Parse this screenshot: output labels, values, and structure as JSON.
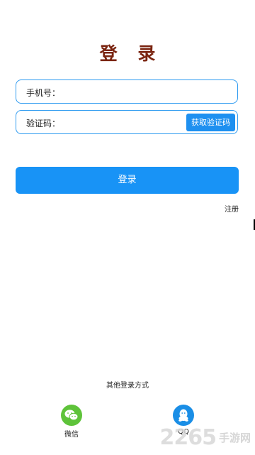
{
  "page": {
    "title": "登 录"
  },
  "form": {
    "phone_label": "手机号：",
    "code_label": "验证码：",
    "get_code_label": "获取验证码"
  },
  "actions": {
    "login_label": "登录",
    "register_label": "注册"
  },
  "other_login": {
    "title": "其他登录方式",
    "options": [
      {
        "label": "微信",
        "icon": "wechat-icon",
        "color": "#5ec33a"
      },
      {
        "label": "QQ",
        "icon": "qq-icon",
        "color": "#1a8ee6"
      }
    ]
  },
  "watermark": {
    "number": "2265",
    "text": "手游网"
  },
  "colors": {
    "title": "#7a2410",
    "primary": "#1893f6",
    "border": "#2f9bf0"
  }
}
